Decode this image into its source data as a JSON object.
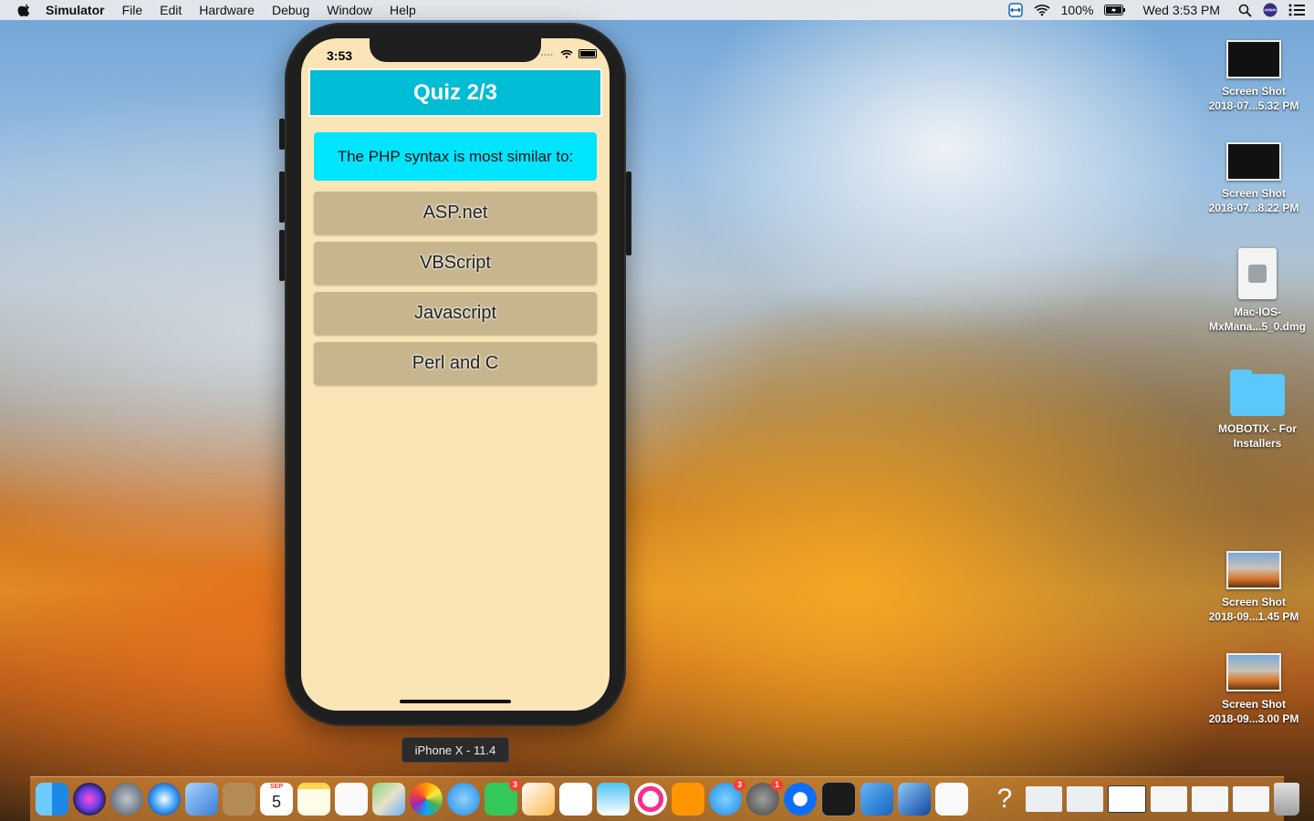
{
  "menubar": {
    "app_name": "Simulator",
    "items": [
      "File",
      "Edit",
      "Hardware",
      "Debug",
      "Window",
      "Help"
    ],
    "battery_text": "100%",
    "clock": "Wed 3:53 PM"
  },
  "phone": {
    "status_time": "3:53",
    "quiz_title": "Quiz 2/3",
    "question": "The PHP syntax is most similar to:",
    "answers": [
      "ASP.net",
      "VBScript",
      "Javascript",
      "Perl and C"
    ],
    "device_label": "iPhone X - 11.4"
  },
  "desktop_icons": [
    {
      "line1": "Screen Shot",
      "line2": "2018-07...5.32 PM"
    },
    {
      "line1": "Screen Shot",
      "line2": "2018-07...8.22 PM"
    },
    {
      "line1": "Mac-IOS-",
      "line2": "MxMana...5_0.dmg"
    },
    {
      "line1": "MOBOTIX - For",
      "line2": "Installers"
    },
    {
      "line1": "Screen Shot",
      "line2": "2018-09...1.45 PM"
    },
    {
      "line1": "Screen Shot",
      "line2": "2018-09...3.00 PM"
    }
  ],
  "dock": {
    "calendar_month": "SEP",
    "calendar_day": "5",
    "facetime_badge": "3",
    "appstore_badge": "3",
    "prefs_badge": "1"
  }
}
